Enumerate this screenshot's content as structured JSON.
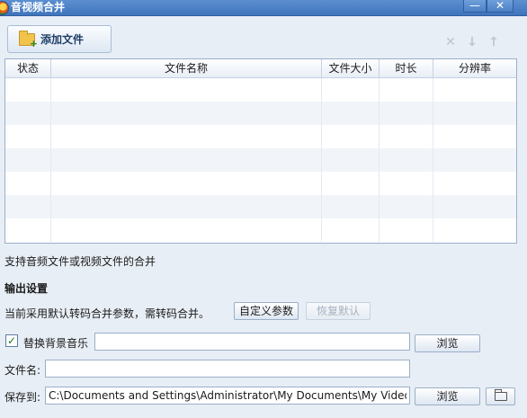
{
  "window": {
    "title": "音视频合并",
    "min_label": "—",
    "close_label": "✕"
  },
  "toolbar": {
    "add_file_label": "添加文件",
    "icons": [
      "delete-icon",
      "move-down-icon",
      "move-up-icon"
    ]
  },
  "table": {
    "columns": [
      "状态",
      "文件名称",
      "文件大小",
      "时长",
      "分辨率"
    ],
    "rows": []
  },
  "info": {
    "support_text": "支持音频文件或视频文件的合并"
  },
  "output": {
    "section_title": "输出设置",
    "current_text": "当前采用默认转码合并参数，需转码合并。",
    "custom_params_label": "自定义参数",
    "restore_default_label": "恢复默认",
    "replace_bg_music_label": "替换背景音乐",
    "replace_bg_music_checked": true,
    "bg_music_value": "",
    "browse_label": "浏览",
    "file_name_label": "文件名:",
    "file_name_value": "",
    "save_to_label": "保存到:",
    "save_to_value": "C:\\Documents and Settings\\Administrator\\My Documents\\My Videos\\"
  },
  "colors": {
    "titlebar": "#3f74bd",
    "background": "#e8eef5",
    "table_border": "#9aafc9"
  }
}
